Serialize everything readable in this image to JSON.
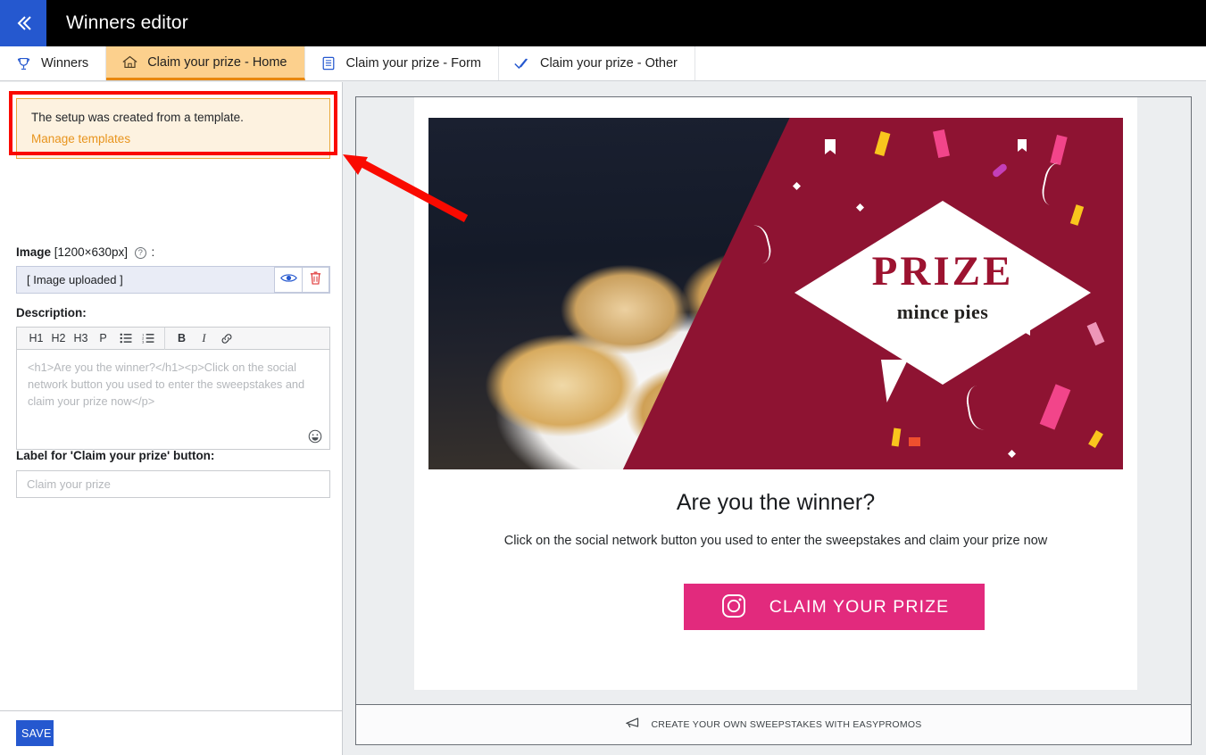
{
  "topbar": {
    "collapse_icon": "double-chevron-left-icon",
    "title": "Winners editor"
  },
  "tabs": [
    {
      "label": "Winners",
      "icon": "trophy-icon",
      "active": false
    },
    {
      "label": "Claim your prize - Home",
      "icon": "home-icon",
      "active": true
    },
    {
      "label": "Claim your prize - Form",
      "icon": "clipboard-icon",
      "active": false
    },
    {
      "label": "Claim your prize - Other",
      "icon": "double-check-icon",
      "active": false
    }
  ],
  "left_panel": {
    "template_note": {
      "text": "The setup was created from a template.",
      "link": "Manage templates"
    },
    "image_field": {
      "label": "Image",
      "dimensions": "[1200×630px]",
      "help_icon": "question-mark-icon",
      "colon": ":",
      "value": "[ Image uploaded ]",
      "preview_icon": "eye-icon",
      "delete_icon": "trash-icon"
    },
    "description_field": {
      "label": "Description:",
      "toolbar": [
        "H1",
        "H2",
        "H3",
        "P",
        "bullet-list-icon",
        "numbered-list-icon",
        "B",
        "I",
        "link-icon"
      ],
      "placeholder": "<h1>Are you the winner?</h1><p>Click on the social network button you used to enter the sweepstakes and claim your prize now</p>",
      "emoji_icon": "smiley-icon"
    },
    "button_label_field": {
      "label": "Label for 'Claim your prize' button:",
      "placeholder": "Claim your prize",
      "value": ""
    },
    "save_label": "SAVE"
  },
  "preview": {
    "hero": {
      "prize_word": "PRIZE",
      "prize_subtitle": "mince pies"
    },
    "title": "Are you the winner?",
    "subtitle": "Click on the social network button you used to enter the sweepstakes and claim your prize now",
    "claim_button": {
      "label": "CLAIM YOUR PRIZE",
      "icon": "instagram-icon"
    },
    "footer": {
      "icon": "megaphone-icon",
      "text": "CREATE YOUR OWN SWEEPSTAKES WITH EASYPROMOS"
    }
  },
  "colors": {
    "topbar_bg": "#000000",
    "collapse_bg": "#2558cf",
    "active_tab_bg": "#fcd08d",
    "active_tab_underline": "#e8870e",
    "note_bg": "#fdf2e0",
    "note_border": "#e9a93a",
    "note_link": "#e8941d",
    "save_bg": "#2558cf",
    "hero_maroon": "#8e1332",
    "prize_text": "#9c1330",
    "claim_button_bg": "#e22a7d",
    "annotation_red": "#fa0a00"
  }
}
